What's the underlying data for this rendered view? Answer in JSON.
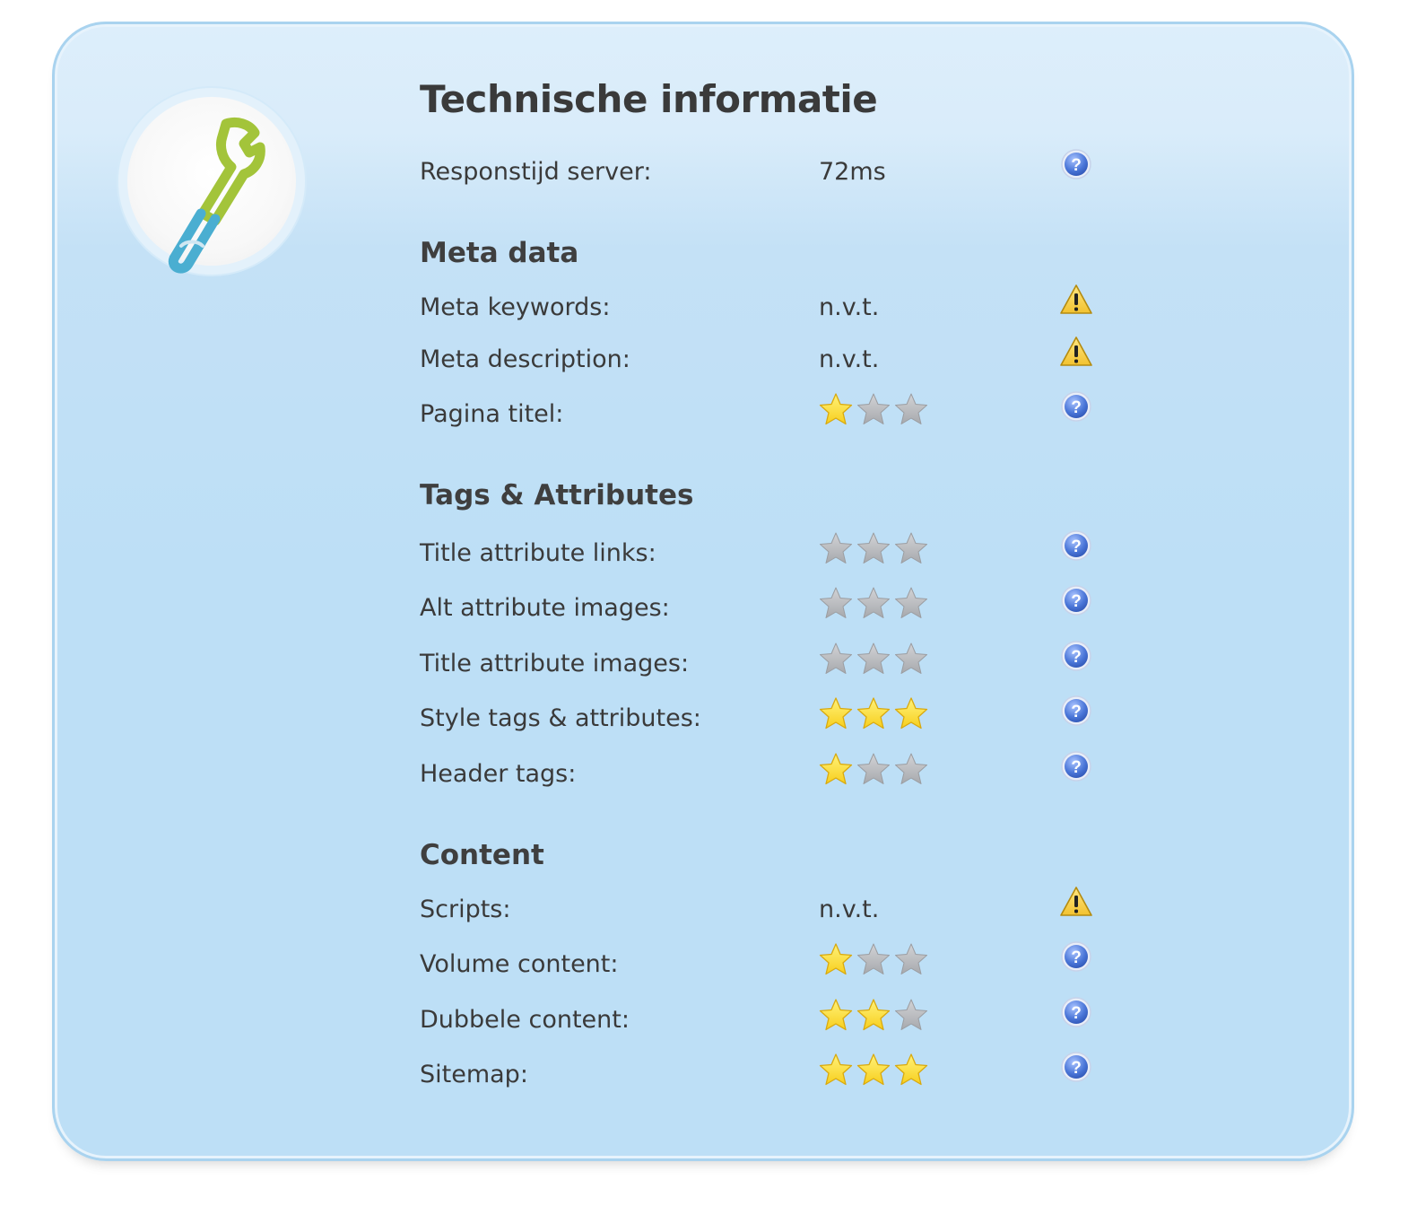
{
  "panel": {
    "icon": "wrench-icon",
    "title": "Technische informatie"
  },
  "server": {
    "label": "Responstijd server:",
    "value": "72ms",
    "status_icon": "help-icon"
  },
  "sections": {
    "meta": "Meta data",
    "tags": "Tags & Attributes",
    "content": "Content"
  },
  "rows": {
    "meta_keywords": {
      "label": "Meta keywords:",
      "value": "n.v.t.",
      "status_icon": "warning-icon"
    },
    "meta_description": {
      "label": "Meta description:",
      "value": "n.v.t.",
      "status_icon": "warning-icon"
    },
    "pagina_titel": {
      "label": "Pagina titel:",
      "rating": 1,
      "max_rating": 3,
      "status_icon": "help-icon"
    },
    "title_links": {
      "label": "Title attribute links:",
      "rating": 0,
      "max_rating": 3,
      "status_icon": "help-icon"
    },
    "alt_images": {
      "label": "Alt attribute images:",
      "rating": 0,
      "max_rating": 3,
      "status_icon": "help-icon"
    },
    "title_images": {
      "label": "Title attribute images:",
      "rating": 0,
      "max_rating": 3,
      "status_icon": "help-icon"
    },
    "style_tags": {
      "label": "Style tags & attributes:",
      "rating": 3,
      "max_rating": 3,
      "status_icon": "help-icon"
    },
    "header_tags": {
      "label": "Header tags:",
      "rating": 1,
      "max_rating": 3,
      "status_icon": "help-icon"
    },
    "scripts": {
      "label": "Scripts:",
      "value": "n.v.t.",
      "status_icon": "warning-icon"
    },
    "volume_content": {
      "label": "Volume content:",
      "rating": 1,
      "max_rating": 3,
      "status_icon": "help-icon"
    },
    "dubbele_content": {
      "label": "Dubbele content:",
      "rating": 2,
      "max_rating": 3,
      "status_icon": "help-icon"
    },
    "sitemap": {
      "label": "Sitemap:",
      "rating": 3,
      "max_rating": 3,
      "status_icon": "help-icon"
    }
  },
  "colors": {
    "panel_background": "#bddff6",
    "panel_border": "#a9d3ef",
    "star_filled": "#f7cf1d",
    "star_empty": "#a7a9ad",
    "help_blue": "#4a76d8",
    "warning_yellow": "#f2c230"
  }
}
